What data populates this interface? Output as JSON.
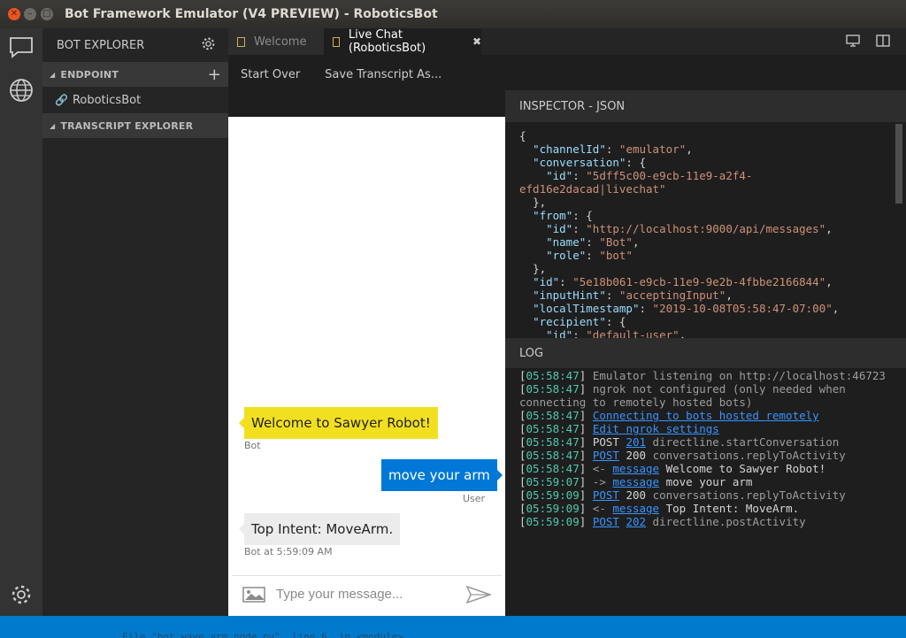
{
  "window": {
    "title": "Bot Framework Emulator (V4 PREVIEW) - RoboticsBot"
  },
  "sidebar": {
    "title": "BOT EXPLORER",
    "endpoint_label": "ENDPOINT",
    "bot_item": "RoboticsBot",
    "transcript_label": "TRANSCRIPT EXPLORER"
  },
  "tabs": [
    {
      "label": "Welcome"
    },
    {
      "label": "Live Chat (RoboticsBot)"
    }
  ],
  "toolbar": {
    "start_over": "Start Over",
    "save_transcript": "Save Transcript As..."
  },
  "chat": {
    "msg1": "Welcome to Sawyer Robot!",
    "msg1_meta": "Bot",
    "msg2": "move your arm",
    "msg2_meta": "User",
    "msg3": "Top Intent: MoveArm.",
    "msg3_meta": "Bot at 5:59:09 AM",
    "input_placeholder": "Type your message..."
  },
  "inspector": {
    "title": "INSPECTOR - JSON",
    "lines": [
      {
        "i": 0,
        "k": "",
        "v": "",
        "p": "{"
      },
      {
        "i": 1,
        "k": "\"channelId\"",
        "v": "\"emulator\"",
        "p": ","
      },
      {
        "i": 1,
        "k": "\"conversation\"",
        "v": "",
        "p": ": {"
      },
      {
        "i": 2,
        "k": "\"id\"",
        "v": "\"5dff5c00-e9cb-11e9-a2f4-",
        "p": ""
      },
      {
        "i": 0,
        "k": "",
        "v": "efd16e2dacad|livechat\"",
        "p": ""
      },
      {
        "i": 1,
        "k": "",
        "v": "",
        "p": "},"
      },
      {
        "i": 1,
        "k": "\"from\"",
        "v": "",
        "p": ": {"
      },
      {
        "i": 2,
        "k": "\"id\"",
        "v": "\"http://localhost:9000/api/messages\"",
        "p": ","
      },
      {
        "i": 2,
        "k": "\"name\"",
        "v": "\"Bot\"",
        "p": ","
      },
      {
        "i": 2,
        "k": "\"role\"",
        "v": "\"bot\"",
        "p": ""
      },
      {
        "i": 1,
        "k": "",
        "v": "",
        "p": "},"
      },
      {
        "i": 1,
        "k": "\"id\"",
        "v": "\"5e18b061-e9cb-11e9-9e2b-4fbbe2166844\"",
        "p": ","
      },
      {
        "i": 1,
        "k": "\"inputHint\"",
        "v": "\"acceptingInput\"",
        "p": ","
      },
      {
        "i": 1,
        "k": "\"localTimestamp\"",
        "v": "\"2019-10-08T05:58:47-07:00\"",
        "p": ","
      },
      {
        "i": 1,
        "k": "\"recipient\"",
        "v": "",
        "p": ": {"
      },
      {
        "i": 2,
        "k": "\"id\"",
        "v": "\"default-user\"",
        "p": ","
      }
    ]
  },
  "log": {
    "title": "LOG",
    "rows": [
      {
        "ts": "05:58:47",
        "parts": [
          {
            "t": "Emulator listening on http://localhost:46723",
            "c": "grey"
          }
        ]
      },
      {
        "ts": "05:58:47",
        "parts": [
          {
            "t": "ngrok not configured (only needed when connecting to remotely hosted bots)",
            "c": "grey"
          }
        ]
      },
      {
        "ts": "05:58:47",
        "parts": [
          {
            "t": "Connecting to bots hosted remotely",
            "c": "lnk"
          }
        ]
      },
      {
        "ts": "05:58:47",
        "parts": [
          {
            "t": "Edit ngrok settings",
            "c": "lnk"
          }
        ]
      },
      {
        "ts": "05:58:47",
        "parts": [
          {
            "t": "POST ",
            "c": "w"
          },
          {
            "t": "201",
            "c": "lnk"
          },
          {
            "t": " directline.startConversation",
            "c": "grey"
          }
        ]
      },
      {
        "ts": "05:58:47",
        "parts": [
          {
            "t": "POST",
            "c": "lnk"
          },
          {
            "t": " 200 ",
            "c": "w"
          },
          {
            "t": "conversations.replyToActivity",
            "c": "grey"
          }
        ]
      },
      {
        "ts": "05:58:47",
        "parts": [
          {
            "t": "<- ",
            "c": "grey"
          },
          {
            "t": "message",
            "c": "lnk"
          },
          {
            "t": " Welcome to Sawyer Robot!",
            "c": "w"
          }
        ]
      },
      {
        "ts": "05:59:07",
        "parts": [
          {
            "t": "-> ",
            "c": "grey"
          },
          {
            "t": "message",
            "c": "lnk"
          },
          {
            "t": " move your arm",
            "c": "w"
          }
        ]
      },
      {
        "ts": "05:59:09",
        "parts": [
          {
            "t": "POST",
            "c": "lnk"
          },
          {
            "t": " 200 ",
            "c": "w"
          },
          {
            "t": "conversations.replyToActivity",
            "c": "grey"
          }
        ]
      },
      {
        "ts": "05:59:09",
        "parts": [
          {
            "t": "<- ",
            "c": "grey"
          },
          {
            "t": "message",
            "c": "lnk"
          },
          {
            "t": " Top Intent: MoveArm.",
            "c": "w"
          }
        ]
      },
      {
        "ts": "05:59:09",
        "parts": [
          {
            "t": "POST",
            "c": "lnk"
          },
          {
            "t": " ",
            "c": "w"
          },
          {
            "t": "202",
            "c": "lnk"
          },
          {
            "t": " directline.postActivity",
            "c": "grey"
          }
        ]
      }
    ]
  },
  "statusbar": {
    "ghost_text": "File \"bot_wave_arm_node.py\", line 6, in <module>"
  },
  "colors": {
    "accent": "#007acc",
    "bot_bubble": "#f2e020",
    "user_bubble": "#0078d7",
    "timestamp": "#4ec9b0",
    "link": "#3794ff"
  }
}
